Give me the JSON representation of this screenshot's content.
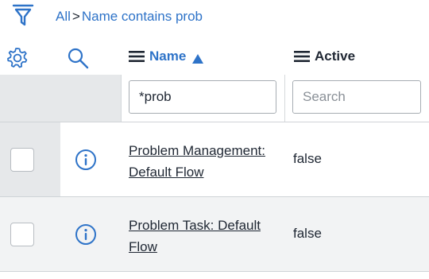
{
  "breadcrumb": {
    "all_label": "All",
    "separator": ">",
    "filter_label": "Name contains prob"
  },
  "columns": {
    "name_label": "Name",
    "active_label": "Active"
  },
  "search": {
    "name_value": "*prob",
    "active_placeholder": "Search"
  },
  "rows": [
    {
      "name": "Problem Management: Default Flow",
      "active": "false"
    },
    {
      "name": "Problem Task: Default Flow",
      "active": "false"
    }
  ],
  "colors": {
    "accent": "#2e73c8",
    "text": "#1f2733",
    "header_bg": "#e6e8ea"
  },
  "icons": [
    "filter-icon",
    "gear-icon",
    "search-icon",
    "menu-icon",
    "sort-ascending-icon",
    "info-icon"
  ]
}
